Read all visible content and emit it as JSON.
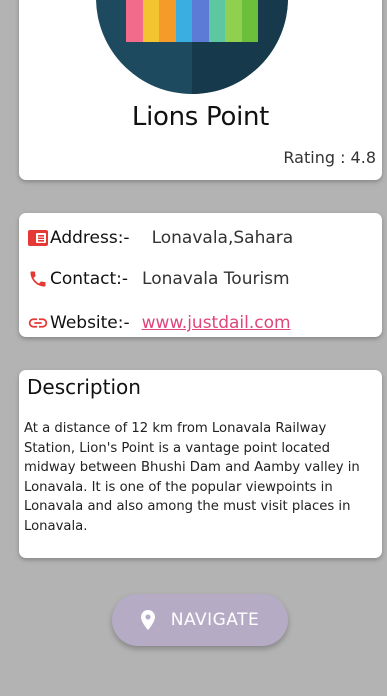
{
  "place": {
    "name": "Lions Point",
    "rating_text": "Rating : 4.8"
  },
  "logo": {
    "circle_color": "#1e4a5f",
    "stripe_colors": [
      "#f26b8a",
      "#f4c430",
      "#f49b2a",
      "#3aaee0",
      "#5b7bd6",
      "#5cc7a0",
      "#8fd14f",
      "#6bbf3a"
    ]
  },
  "info": {
    "address": {
      "icon": "address-card-icon",
      "label": "Address:-",
      "value": "Lonavala,Sahara"
    },
    "contact": {
      "icon": "phone-icon",
      "label": "Contact:-",
      "value": "Lonavala Tourism"
    },
    "website": {
      "icon": "link-icon",
      "label": "Website:-",
      "value": "www.justdail.com"
    }
  },
  "description": {
    "title": "Description",
    "body": "At a distance of 12 km from Lonavala Railway Station, Lion's Point is a vantage point located midway between Bhushi Dam and Aamby valley in Lonavala. It is one of the popular viewpoints in Lonavala and also among the must visit places in Lonavala."
  },
  "navigate": {
    "icon": "location-pin-icon",
    "label": "NAVIGATE"
  },
  "colors": {
    "background": "#b3b3b3",
    "accent_red": "#e53935",
    "link": "#e0457b",
    "button": "#b6abc4"
  }
}
